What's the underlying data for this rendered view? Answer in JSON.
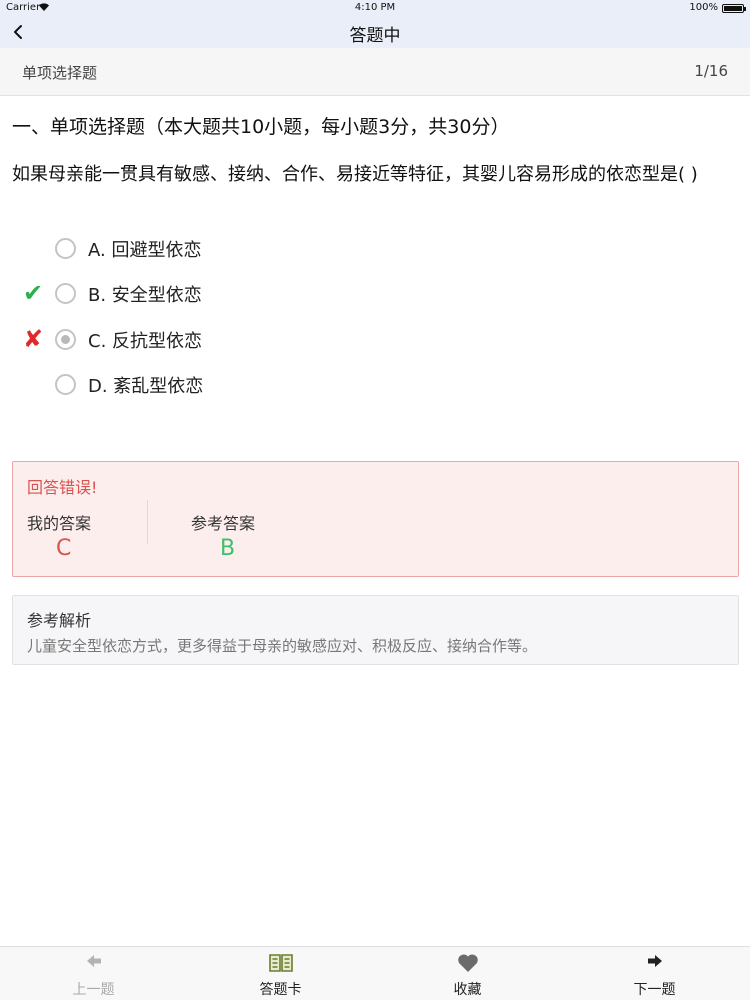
{
  "status_bar": {
    "carrier": "Carrier",
    "time": "4:10 PM",
    "battery": "100%"
  },
  "nav": {
    "title": "答题中"
  },
  "sub_header": {
    "type": "单项选择题",
    "progress": "1/16"
  },
  "section_title": "一、单项选择题（本大题共10小题，每小题3分，共30分）",
  "question": "如果母亲能一贯具有敏感、接纳、合作、易接近等特征，其婴儿容易形成的依恋型是(   )",
  "options": [
    {
      "label": "A. 回避型依恋",
      "mark": "",
      "selected": false
    },
    {
      "label": "B. 安全型依恋",
      "mark": "✔",
      "selected": false
    },
    {
      "label": "C. 反抗型依恋",
      "mark": "✘",
      "selected": true
    },
    {
      "label": "D. 紊乱型依恋",
      "mark": "",
      "selected": false
    }
  ],
  "result": {
    "heading": "回答错误!",
    "my_answer_label": "我的答案",
    "my_answer": "C",
    "ref_answer_label": "参考答案",
    "ref_answer": "B",
    "wrong_color": "#d9534f",
    "correct_color": "#3cc06b"
  },
  "explanation": {
    "heading": "参考解析",
    "text": "儿童安全型依恋方式，更多得益于母亲的敏感应对、积极反应、接纳合作等。"
  },
  "tabs": [
    {
      "label": "上一题",
      "icon": "arrow-left-icon",
      "enabled": false
    },
    {
      "label": "答题卡",
      "icon": "book-icon",
      "enabled": true
    },
    {
      "label": "收藏",
      "icon": "heart-icon",
      "enabled": true
    },
    {
      "label": "下一题",
      "icon": "arrow-right-icon",
      "enabled": true
    }
  ]
}
